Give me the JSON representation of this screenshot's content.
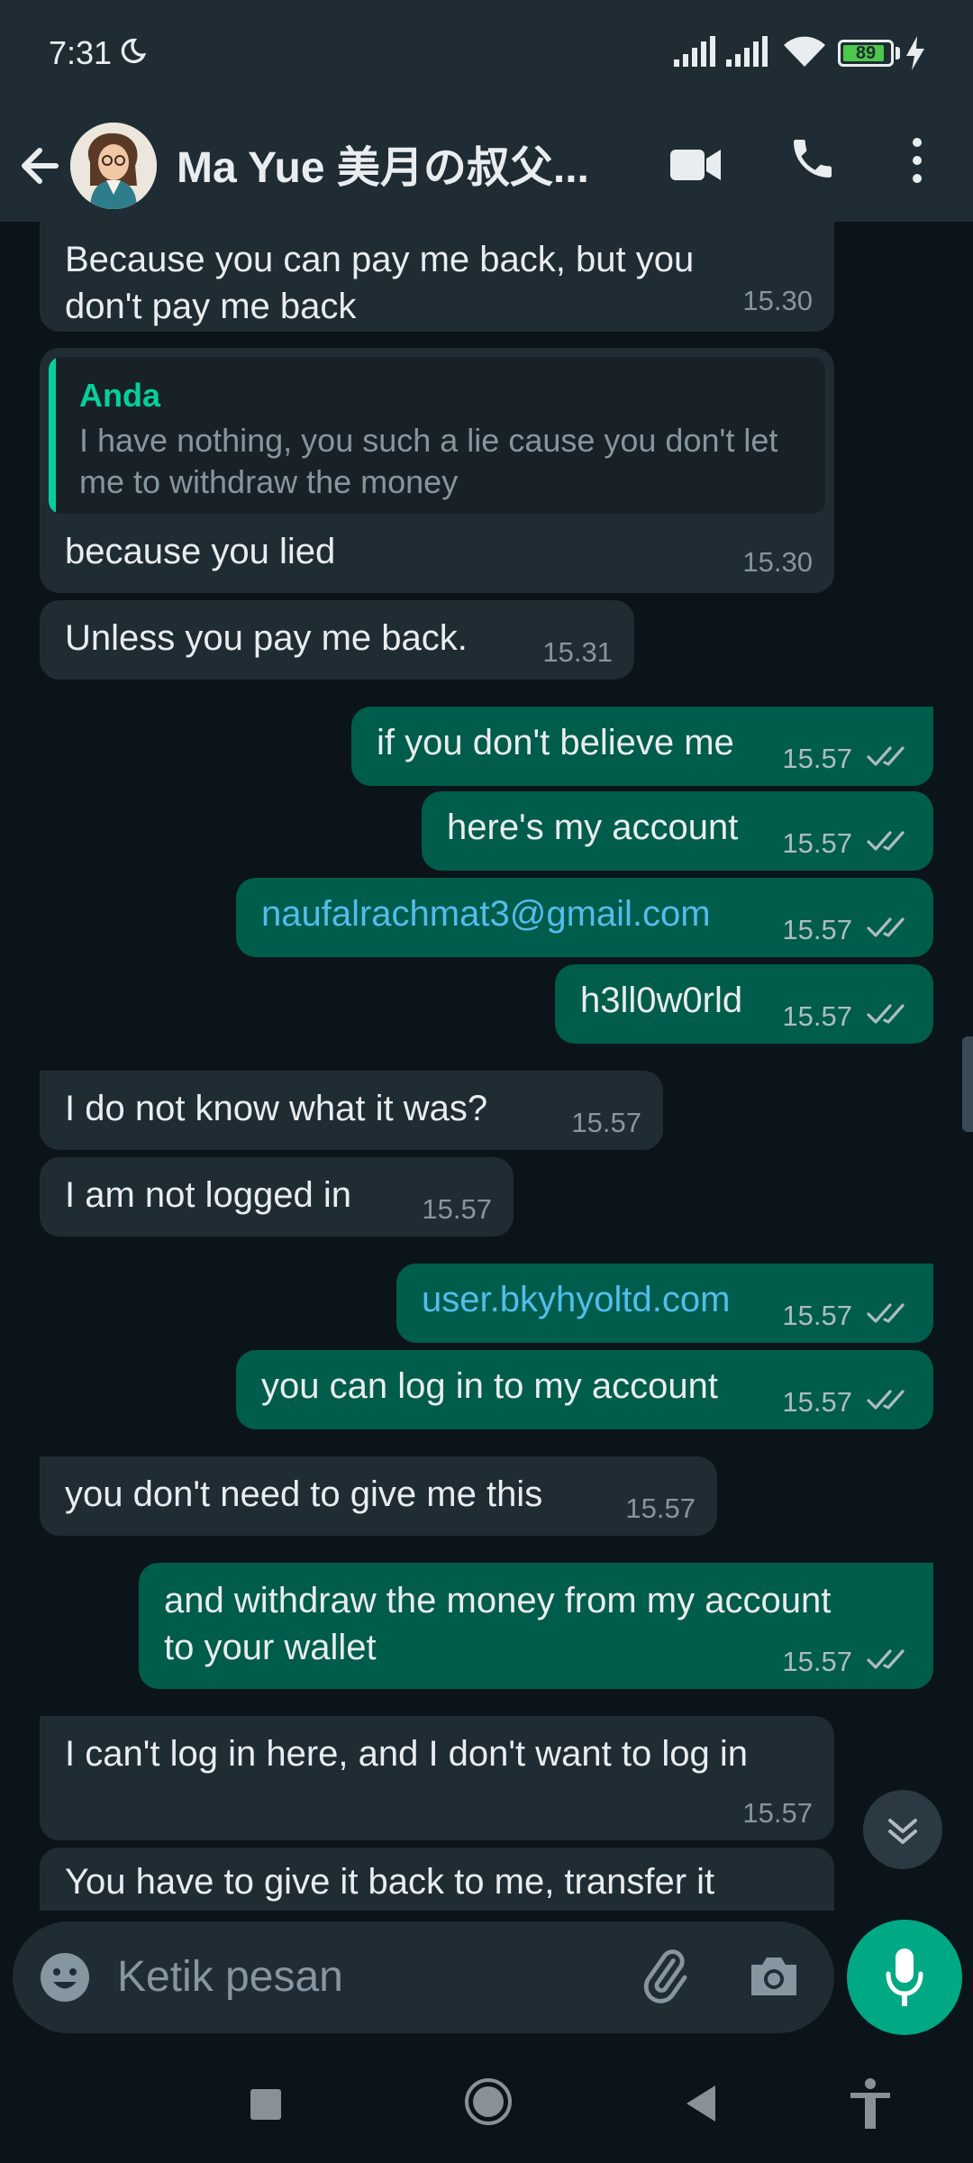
{
  "status_bar": {
    "time": "7:31",
    "battery": "89",
    "battery_level_pct": 89
  },
  "header": {
    "title": "Ma Yue 美月の叔父..."
  },
  "messages": [
    {
      "dir": "in",
      "text": "Because you can pay me back, but you\ndon't pay me back",
      "time": "15.30"
    },
    {
      "dir": "in",
      "reply_author": "Anda",
      "reply_text": "I have nothing, you such a lie cause you don't let me to withdraw the money",
      "text": "because you lied",
      "time": "15.30"
    },
    {
      "dir": "in",
      "text": "Unless you pay me back.",
      "time": "15.31"
    },
    {
      "dir": "out",
      "text": "if you don't believe me",
      "time": "15.57"
    },
    {
      "dir": "out",
      "text": "here's my account",
      "time": "15.57"
    },
    {
      "dir": "out",
      "text": "naufalrachmat3@gmail.com",
      "time": "15.57",
      "link": true
    },
    {
      "dir": "out",
      "text": "h3ll0w0rld",
      "time": "15.57"
    },
    {
      "dir": "in",
      "text": "I do not know what it was?",
      "time": "15.57"
    },
    {
      "dir": "in",
      "text": "I am not logged in",
      "time": "15.57"
    },
    {
      "dir": "out",
      "text": "user.bkyhyoltd.com",
      "time": "15.57",
      "link": true
    },
    {
      "dir": "out",
      "text": "you can log in to my account",
      "time": "15.57"
    },
    {
      "dir": "in",
      "text": "you don't need to give me this",
      "time": "15.57"
    },
    {
      "dir": "out",
      "text": "and withdraw the money from my account\nto your wallet",
      "time": "15.57"
    },
    {
      "dir": "in",
      "text": "I can't log in here, and I don't want to log in",
      "time": "15.57"
    },
    {
      "dir": "in",
      "text": "You have to give it back to me, transfer it",
      "time": ""
    }
  ],
  "composer": {
    "placeholder": "Ketik pesan"
  },
  "colors": {
    "incoming": "#1f2c34",
    "outgoing": "#005c4b",
    "accent": "#00a884",
    "link": "#53bdeb",
    "read_ticks": "#53bdeb"
  },
  "icons": [
    "back-arrow-icon",
    "video-call-icon",
    "voice-call-icon",
    "more-vert-icon",
    "emoji-icon",
    "attach-icon",
    "camera-icon",
    "mic-icon",
    "double-check-icon",
    "chevron-double-down-icon"
  ]
}
